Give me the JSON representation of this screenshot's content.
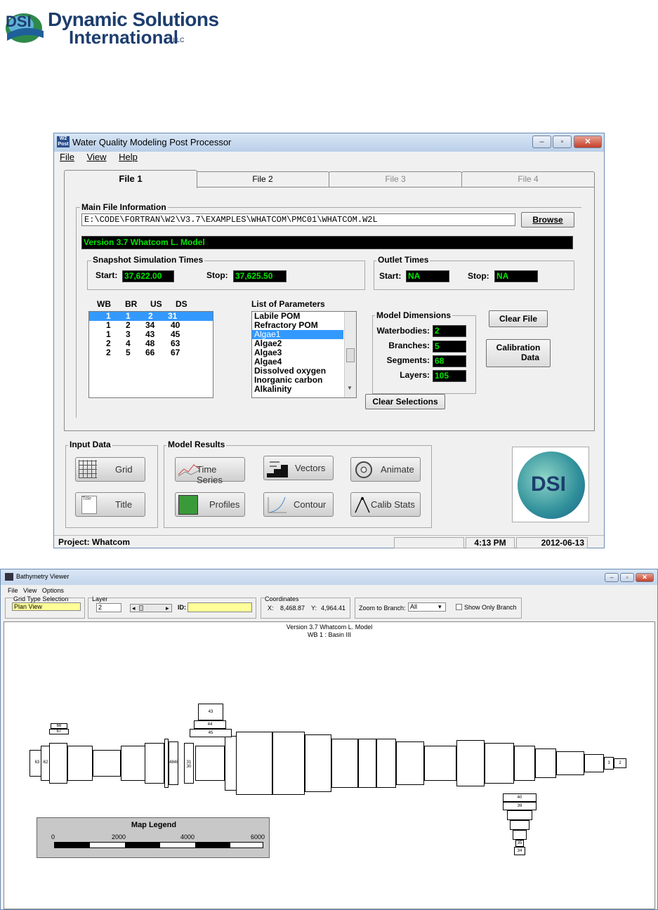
{
  "logo": {
    "line1": "Dynamic Solutions",
    "line2": "International",
    "llc": "LLC",
    "mark": "DSI"
  },
  "main_window": {
    "title": "Water Quality Modeling Post Processor",
    "icon_text": "W2 Post",
    "menu": [
      "File",
      "View",
      "Help"
    ],
    "tabs": [
      "File 1",
      "File 2",
      "File 3",
      "File 4"
    ],
    "main_file": {
      "group_label": "Main File Information",
      "path": "E:\\CODE\\FORTRAN\\W2\\V3.7\\EXAMPLES\\WHATCOM\\PMC01\\WHATCOM.W2L",
      "browse": "Browse",
      "version": "Version 3.7 Whatcom L. Model"
    },
    "snapshot": {
      "label": "Snapshot Simulation Times",
      "start_label": "Start:",
      "start": "37,622.00",
      "stop_label": "Stop:",
      "stop": "37,625.50"
    },
    "outlet": {
      "label": "Outlet Times",
      "start_label": "Start:",
      "start": "NA",
      "stop_label": "Stop:",
      "stop": "NA"
    },
    "wb_table": {
      "headers": [
        "WB",
        "BR",
        "US",
        "DS"
      ],
      "rows": [
        [
          "1",
          "1",
          "2",
          "31"
        ],
        [
          "1",
          "2",
          "34",
          "40"
        ],
        [
          "1",
          "3",
          "43",
          "45"
        ],
        [
          "2",
          "4",
          "48",
          "63"
        ],
        [
          "2",
          "5",
          "66",
          "67"
        ]
      ]
    },
    "params": {
      "label": "List of Parameters",
      "items": [
        "Labile POM",
        "Refractory POM",
        "Algae1",
        "Algae2",
        "Algae3",
        "Algae4",
        "Dissolved oxygen",
        "Inorganic carbon",
        "Alkalinity"
      ],
      "selected": "Algae1"
    },
    "dims": {
      "label": "Model Dimensions",
      "waterbodies_label": "Waterbodies:",
      "waterbodies": "2",
      "branches_label": "Branches:",
      "branches": "5",
      "segments_label": "Segments:",
      "segments": "68",
      "layers_label": "Layers:",
      "layers": "105"
    },
    "clear_file": "Clear File",
    "calib_line1": "Calibration",
    "calib_line2": "Data",
    "clear_sel": "Clear Selections",
    "input_group": "Input Data",
    "results_group": "Model Results",
    "buttons": {
      "grid": "Grid",
      "title": "Title",
      "time_series": "Time Series",
      "profiles": "Profiles",
      "vectors": "Vectors",
      "contour": "Contour",
      "animate": "Animate",
      "calib_stats": "Calib Stats"
    },
    "title_icon_text": "Title",
    "logo_mark": "DSI",
    "status": {
      "project": "Project: Whatcom",
      "time": "4:13 PM",
      "date": "2012-06-13"
    }
  },
  "bathy_window": {
    "title": "Bathymetry Viewer",
    "menu": [
      "File",
      "View",
      "Options"
    ],
    "grid_type_label": "Grid Type Selection",
    "grid_type_value": "Plan View",
    "layer_label": "Layer",
    "layer_value": "2",
    "id_label": "ID:",
    "coord_label": "Coordinates",
    "x_label": "X:",
    "x_value": "8,468.87",
    "y_label": "Y:",
    "y_value": "4,964.41",
    "zoom_label": "Zoom to Branch:",
    "zoom_value": "All",
    "show_only": "Show Only Branch",
    "plot_title": "Version 3.7 Whatcom L. Model",
    "plot_subtitle": "WB 1 : Basin III",
    "legend_title": "Map Legend",
    "scale": [
      "0",
      "2000",
      "4000",
      "6000"
    ],
    "seg_labels": {
      "s43": "43",
      "s44": "44",
      "s45": "45",
      "s66": "66",
      "s67": "67",
      "s63": "63",
      "s62": "62",
      "s48": "4848",
      "s31": "31 30",
      "s3": "3",
      "s2": "2",
      "s40": "40",
      "s39": "39",
      "s35": "35",
      "s34": "34"
    }
  }
}
